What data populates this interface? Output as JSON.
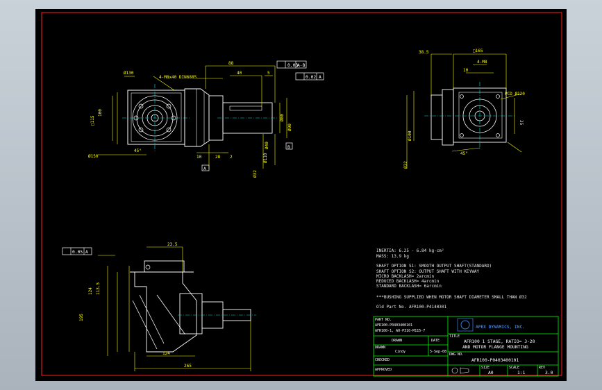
{
  "colors": {
    "background": "#000000",
    "border": "#ff2020",
    "body": "#ffffff",
    "dimension": "#ffff00",
    "center": "#00e0e0",
    "title_frame": "#00ff00",
    "logo": "#3a7bd5"
  },
  "front_view": {
    "dims": {
      "bolt_circle": "Ø130",
      "tap": "4-M8x40 DIN6885",
      "len_88": "88",
      "len_40": "40",
      "len_5": "5",
      "square_115": "□115",
      "len_100": "100",
      "pcd_150": "Ø150",
      "len_10": "10",
      "len_28": "28",
      "len_2": "2",
      "angle_45": "45°",
      "shaft_40": "Ø40",
      "shaft_80": "Ø80",
      "pilot_90": "Ø90",
      "bore_32": "Ø32",
      "flange_110": "Ø110"
    },
    "tolerances": {
      "fc1_value": "0.03",
      "fc1_datum": "A-B",
      "fc2_value": "0.02",
      "fc2_datum": "A"
    },
    "datums": {
      "a": "A",
      "b": "B"
    }
  },
  "side_view": {
    "dims": {
      "len_385": "38.5",
      "square_165": "□165",
      "keys": "4-M8",
      "len_10": "10",
      "pcd": "PCD Ø120",
      "bore_100": "Ø100",
      "bore_32": "Ø32",
      "angle_45": "45°",
      "len_35": "35"
    }
  },
  "bottom_view": {
    "dims": {
      "fc_value": "0.05",
      "fc_datum": "A",
      "len_235": "23.5",
      "len_124": "124",
      "len_1135": "113.5",
      "len_195": "195",
      "len_265": "265"
    }
  },
  "notes": {
    "inertia": "INERTIA:   6.25 - 6.84 kg-cm²",
    "mass": "MASS:  13.9 kg",
    "shaft_s1": "SHAFT OPTION S1: SMOOTH OUTPUT SHAFT(STANDARD)",
    "shaft_s2": "SHAFT OPTION S2: OUTPUT SHAFT WITH KEYWAY",
    "micro": "MICRO BACKLASH= 2arcmin",
    "reduced": "REDUCED BACKLASH= 4arcmin",
    "standard": "STANDARD BACKLASH= 6arcmin",
    "bushing": "***BUSHING SUPPLIED WHEN MOTOR SHAFT DIAMETER SMALL THAN Ø32",
    "old_part": "Old Part No. AFR100-P4140301"
  },
  "title_block": {
    "part_no_label": "PART NO.",
    "part_no_line1": "AFR100-P0403400101",
    "part_no_line2": "AFR100-1, A0-P310-M115-7",
    "drawn_label": "DRAWN",
    "drawn_by": "Cindy",
    "drawn_date": "5-Sep-08",
    "date_label": "DATE",
    "company": "APEX DYNAMICS, INC.",
    "title_label": "TITLE",
    "title_line1": "AFR100 1 STAGE, RATIO= 3-20",
    "title_line2": "AND MOTOR FLANGE MOUNTING",
    "checked_label": "CHECKED",
    "dwg_label": "DWG NO.",
    "dwg_no": "AFR100-P0403400101",
    "approved_label": "APPROVED",
    "size_label": "SIZE",
    "size_val": "A0",
    "scale_label": "SCALE",
    "scale_val": "1:1",
    "rev_label": "REV",
    "rev_val": "3.0"
  }
}
